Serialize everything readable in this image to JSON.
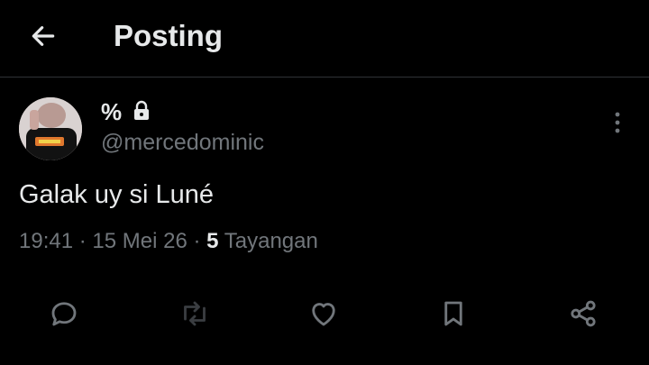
{
  "header": {
    "title": "Posting",
    "back_icon": "arrow-left-icon"
  },
  "post": {
    "display_name": "%",
    "handle": "@mercedominic",
    "text": "Galak uy si Luné",
    "time": "19:41",
    "date": "15 Mei 26",
    "views_count": "5",
    "views_label": "Tayangan",
    "separator": "·"
  },
  "actions": [
    "reply-icon",
    "repost-icon",
    "like-icon",
    "bookmark-icon",
    "share-icon"
  ],
  "colors": {
    "background": "#000000",
    "text": "#e7e9ea",
    "muted": "#71767b",
    "divider": "#2f3336"
  }
}
